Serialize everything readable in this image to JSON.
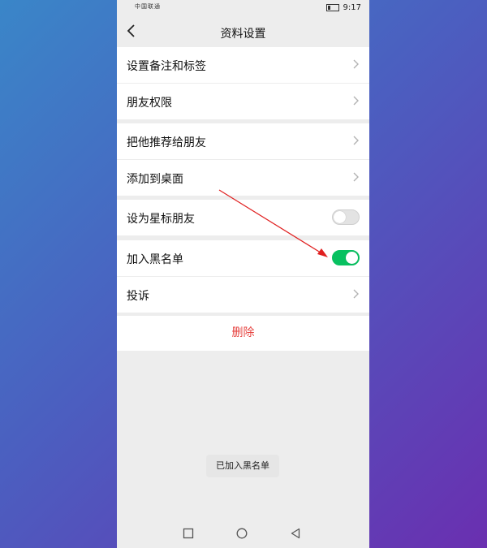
{
  "statusbar": {
    "carrier": "中国联通",
    "time": "9:17"
  },
  "header": {
    "title": "资料设置",
    "back_icon": "chevron-left-icon"
  },
  "groups": {
    "g1": [
      {
        "label": "设置备注和标签"
      },
      {
        "label": "朋友权限"
      }
    ],
    "g2": [
      {
        "label": "把他推荐给朋友"
      },
      {
        "label": "添加到桌面"
      }
    ],
    "g3": [
      {
        "label": "设为星标朋友",
        "toggle": false
      }
    ],
    "g4": [
      {
        "label": "加入黑名单",
        "toggle": true
      },
      {
        "label": "投诉"
      }
    ]
  },
  "delete_label": "删除",
  "toast": "已加入黑名单",
  "colors": {
    "accent": "#07c160",
    "danger": "#e64340",
    "annotation": "#e02020"
  }
}
